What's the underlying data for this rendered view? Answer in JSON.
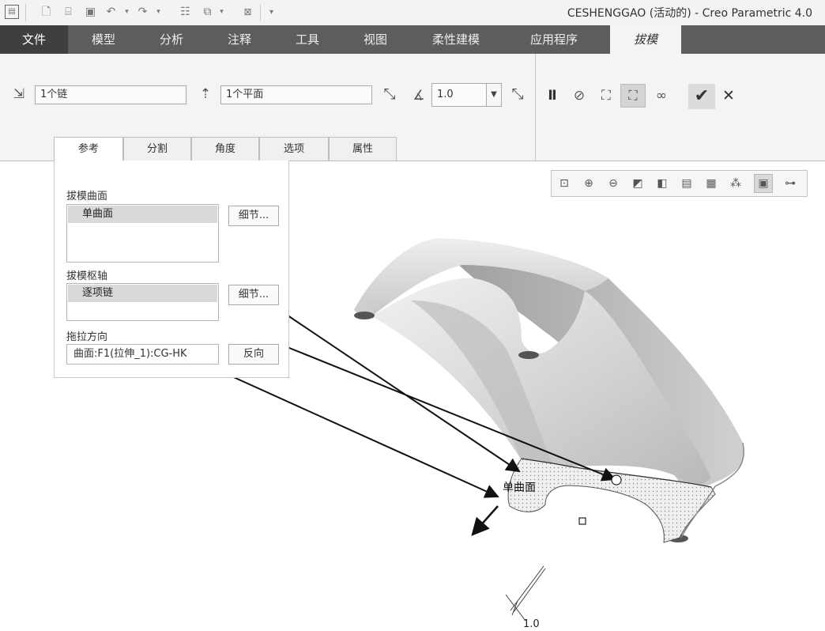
{
  "window": {
    "title": "CESHENGGAO (活动的) - Creo Parametric 4.0"
  },
  "quick_access": [
    "app-menu-icon",
    "new-file-icon",
    "open-file-icon",
    "save-icon",
    "undo-icon",
    "redo-icon",
    "regenerate-icon",
    "windows-icon",
    "close-window-icon",
    "customize-icon"
  ],
  "tabs": [
    {
      "label": "文件"
    },
    {
      "label": "模型"
    },
    {
      "label": "分析"
    },
    {
      "label": "注释"
    },
    {
      "label": "工具"
    },
    {
      "label": "视图"
    },
    {
      "label": "柔性建模"
    },
    {
      "label": "应用程序"
    },
    {
      "label": "拔模"
    }
  ],
  "ribbon": {
    "surfaces_field": "1个链",
    "pivot_field": "1个平面",
    "angle_value": "1.0",
    "subtabs": [
      {
        "label": "参考"
      },
      {
        "label": "分割"
      },
      {
        "label": "角度"
      },
      {
        "label": "选项"
      },
      {
        "label": "属性"
      }
    ]
  },
  "panel": {
    "draft_surface_label": "拔模曲面",
    "draft_surface_item": "单曲面",
    "details_label": "细节...",
    "hinge_label": "拔模枢轴",
    "hinge_item": "逐项链",
    "pull_dir_label": "拖拉方向",
    "pull_dir_value": "曲面:F1(拉伸_1):CG-HK",
    "flip_label": "反向"
  },
  "viewport": {
    "surface_tag": "单曲面",
    "angle_tag": "1.0"
  },
  "graphics_toolbar": [
    "refit-icon",
    "zoom-in-icon",
    "zoom-out-icon",
    "repaint-icon",
    "display-style-icon",
    "saved-views-icon",
    "view-manager-icon",
    "datum-display-icon",
    "annotation-display-icon",
    "spin-center-icon"
  ]
}
